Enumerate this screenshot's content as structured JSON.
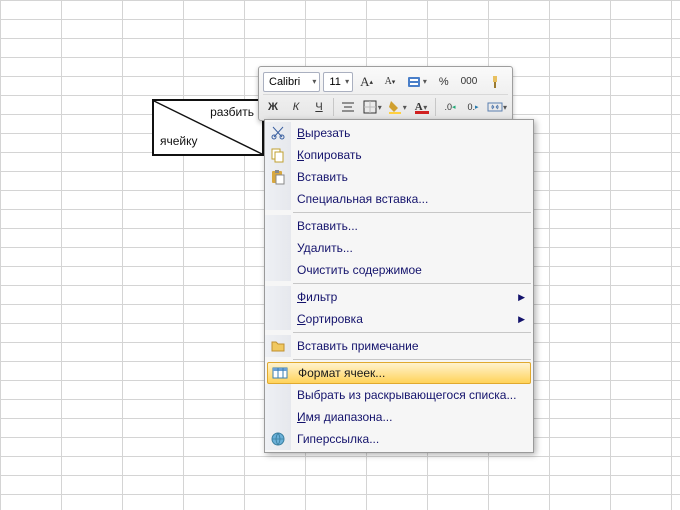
{
  "split_cell": {
    "top_text": "разбить",
    "bottom_text": "ячейку"
  },
  "mini_toolbar": {
    "font_name": "Calibri",
    "font_size": "11",
    "percent_label": "%",
    "thousands_label": "000",
    "bold_label": "Ж",
    "italic_label": "К",
    "underline_label": "Ч",
    "font_color_letter": "A",
    "decimal_inc": ".0",
    "decimal_dec": "0.",
    "increase_font_letter": "A",
    "decrease_font_letter": "A"
  },
  "context_menu": {
    "icons": {
      "cut": "scissors-icon",
      "copy": "copy-icon",
      "paste": "paste-icon",
      "comment": "folder-icon",
      "format_cells": "format-cells-icon",
      "hyperlink": "hyperlink-icon"
    },
    "items": [
      {
        "id": "cut",
        "label": "Вырезать",
        "icon": "cut"
      },
      {
        "id": "copy",
        "label": "Копировать",
        "icon": "copy"
      },
      {
        "id": "paste",
        "label": "Вставить",
        "icon": "paste"
      },
      {
        "id": "paste_special",
        "label": "Специальная вставка..."
      },
      {
        "sep": true
      },
      {
        "id": "insert",
        "label": "Вставить..."
      },
      {
        "id": "delete",
        "label": "Удалить..."
      },
      {
        "id": "clear",
        "label": "Очистить содержимое"
      },
      {
        "sep": true
      },
      {
        "id": "filter",
        "label": "Фильтр",
        "submenu": true
      },
      {
        "id": "sort",
        "label": "Сортировка",
        "submenu": true
      },
      {
        "sep": true
      },
      {
        "id": "comment",
        "label": "Вставить примечание",
        "icon": "comment"
      },
      {
        "sep": true
      },
      {
        "id": "format_cells",
        "label": "Формат ячеек...",
        "icon": "format_cells",
        "highlighted": true
      },
      {
        "id": "dropdown_list",
        "label": "Выбрать из раскрывающегося списка..."
      },
      {
        "id": "name_range",
        "label": "Имя диапазона..."
      },
      {
        "id": "hyperlink",
        "label": "Гиперссылка...",
        "icon": "hyperlink"
      }
    ]
  }
}
